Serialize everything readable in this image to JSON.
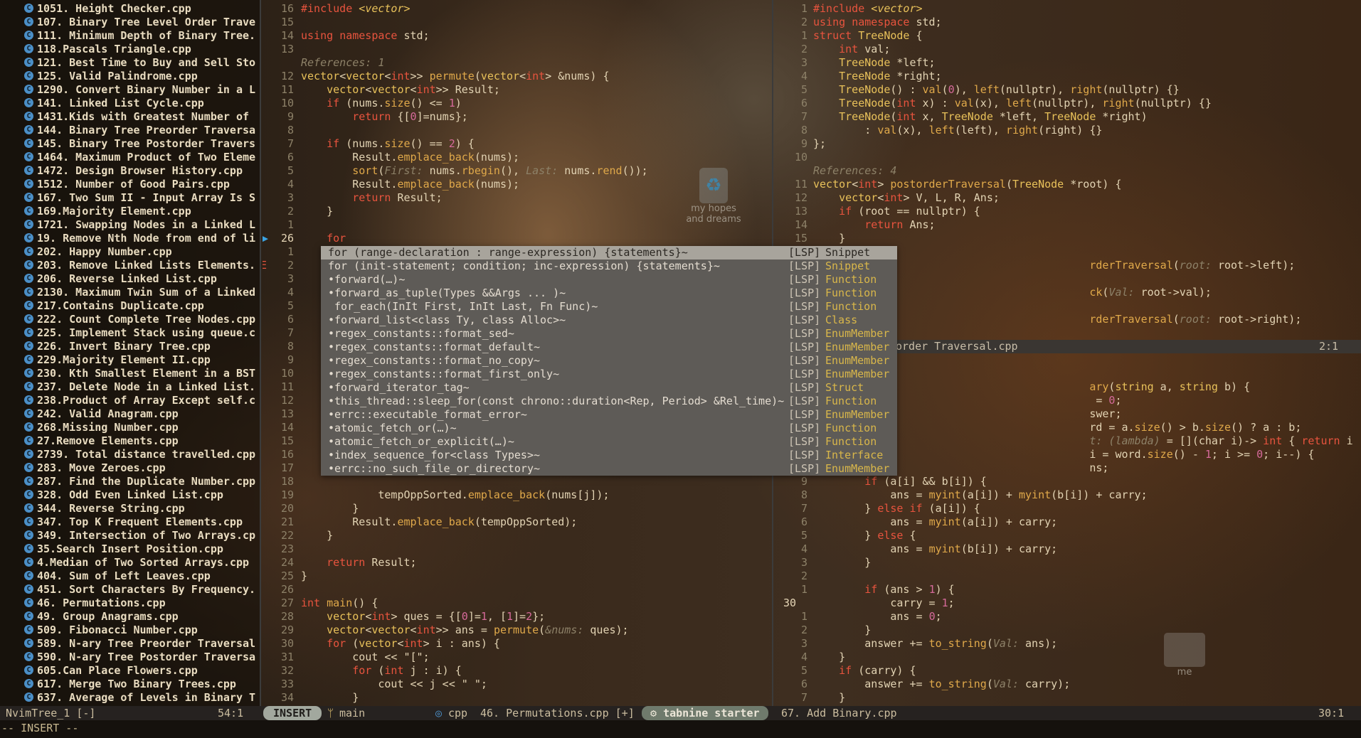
{
  "tree": {
    "items": [
      "1051. Height Checker.cpp",
      "107. Binary Tree Level Order Trave",
      "111. Minimum Depth of Binary Tree.",
      "118.Pascals Triangle.cpp",
      "121. Best Time to Buy and Sell Sto",
      "125. Valid Palindrome.cpp",
      "1290. Convert Binary Number in a L",
      "141. Linked List Cycle.cpp",
      "1431.Kids with Greatest Number of ",
      "144. Binary Tree Preorder Traversa",
      "145. Binary Tree Postorder Travers",
      "1464. Maximum Product of Two Eleme",
      "1472. Design Browser History.cpp",
      "1512. Number of Good Pairs.cpp",
      "167. Two Sum II - Input Array Is S",
      "169.Majority Element.cpp",
      "1721. Swapping Nodes in a Linked L",
      "19. Remove Nth Node from end of li",
      "202. Happy Number.cpp",
      "203. Remove Linked Lists Elements.",
      "206. Reverse Linked List.cpp",
      "2130. Maximum Twin Sum of a Linked",
      "217.Contains Duplicate.cpp",
      "222. Count Complete Tree Nodes.cpp",
      "225. Implement Stack using queue.c",
      "226. Invert Binary Tree.cpp",
      "229.Majority Element II.cpp",
      "230. Kth Smallest Element in a BST",
      "237. Delete Node in a Linked List.",
      "238.Product of Array Except self.c",
      "242. Valid Anagram.cpp",
      "268.Missing Number.cpp",
      "27.Remove Elements.cpp",
      "2739. Total distance travelled.cpp",
      "283. Move Zeroes.cpp",
      "287. Find the Duplicate Number.cpp",
      "328. Odd Even Linked List.cpp",
      "344. Reverse String.cpp",
      "347. Top K Frequent Elements.cpp",
      "349. Intersection of Two Arrays.cp",
      "35.Search Insert Position.cpp",
      "4.Median of Two Sorted Arrays.cpp",
      "404. Sum of Left Leaves.cpp",
      "451. Sort Characters By Frequency.",
      "46. Permutations.cpp",
      "49. Group Anagrams.cpp",
      "509. Fibonacci Number.cpp",
      "589. N-ary Tree Preorder Traversal",
      "590. N-ary Tree Postorder Traversa",
      "605.Can Place Flowers.cpp",
      "617. Merge Two Binary Trees.cpp",
      "637. Average of Levels in Binary T"
    ],
    "icon": "cpp-file-icon"
  },
  "gutter": {
    "error_mark": "E"
  },
  "mid": {
    "nums": [
      "16",
      "15",
      "14",
      "13",
      "",
      "12",
      "11",
      "10",
      "9",
      "8",
      "7",
      "6",
      "5",
      "4",
      "3",
      "2",
      "1",
      "26",
      "1",
      "2",
      "3",
      "4",
      "5",
      "6",
      "7",
      "8",
      "9",
      "10",
      "11",
      "12",
      "13",
      "14",
      "15",
      "16",
      "17",
      "18",
      "19",
      "20",
      "21",
      "22",
      "23",
      "24",
      "25",
      "26",
      "27",
      "28",
      "29",
      "30",
      "31",
      "32",
      "33",
      "34"
    ],
    "references": "References: 1"
  },
  "popup": {
    "items": [
      {
        "label": "for (range-declaration : range-expression) {statements}~",
        "src": "[LSP]",
        "kind": "Snippet"
      },
      {
        "label": "for (init-statement; condition; inc-expression) {statements}~",
        "src": "[LSP]",
        "kind": "Snippet"
      },
      {
        "label": "•forward(…)~",
        "src": "[LSP]",
        "kind": "Function"
      },
      {
        "label": "•forward_as_tuple(Types &&Args ... )~",
        "src": "[LSP]",
        "kind": "Function"
      },
      {
        "label": " for_each(InIt First, InIt Last, Fn Func)~",
        "src": "[LSP]",
        "kind": "Function"
      },
      {
        "label": "•forward_list<class Ty, class Alloc>~",
        "src": "[LSP]",
        "kind": "Class"
      },
      {
        "label": "•regex_constants::format_sed~",
        "src": "[LSP]",
        "kind": "EnumMember"
      },
      {
        "label": "•regex_constants::format_default~",
        "src": "[LSP]",
        "kind": "EnumMember"
      },
      {
        "label": "•regex_constants::format_no_copy~",
        "src": "[LSP]",
        "kind": "EnumMember"
      },
      {
        "label": "•regex_constants::format_first_only~",
        "src": "[LSP]",
        "kind": "EnumMember"
      },
      {
        "label": "•forward_iterator_tag~",
        "src": "[LSP]",
        "kind": "Struct"
      },
      {
        "label": "•this_thread::sleep_for(const chrono::duration<Rep, Period> &Rel_time)~",
        "src": "[LSP]",
        "kind": "Function"
      },
      {
        "label": "•errc::executable_format_error~",
        "src": "[LSP]",
        "kind": "EnumMember"
      },
      {
        "label": "•atomic_fetch_or(…)~",
        "src": "[LSP]",
        "kind": "Function"
      },
      {
        "label": "•atomic_fetch_or_explicit(…)~",
        "src": "[LSP]",
        "kind": "Function"
      },
      {
        "label": "•index_sequence_for<class Types>~",
        "src": "[LSP]",
        "kind": "Interface"
      },
      {
        "label": "•errc::no_such_file_or_directory~",
        "src": "[LSP]",
        "kind": "EnumMember"
      }
    ]
  },
  "right": {
    "nums": [
      "1",
      "2",
      "1",
      "2",
      "3",
      "4",
      "5",
      "6",
      "7",
      "8",
      "9",
      "10",
      "",
      "11",
      "12",
      "13",
      "14",
      "15",
      "",
      "",
      "",
      "",
      "",
      "",
      "",
      "",
      "",
      "",
      "",
      "",
      "",
      "",
      "",
      "",
      "",
      "9",
      "8",
      "7",
      "6",
      "5",
      "4",
      "3",
      "2",
      "1",
      "30",
      "1",
      "2",
      "3",
      "4",
      "5",
      "6",
      "7"
    ],
    "references": "References: 4",
    "inner_status": {
      "file": "order Traversal.cpp",
      "pos": "2:1"
    }
  },
  "status": {
    "tree_name": "NvimTree_1 [-]",
    "tree_pos": "54:1",
    "mode": "INSERT",
    "branch_icon": "ᛘ",
    "branch": "main",
    "lang_icon": "◎",
    "lang": "cpp",
    "file": "46. Permutations.cpp [+]",
    "plugin_icon": "⚙",
    "plugin": "tabnine starter",
    "right_file": "67. Add Binary.cpp",
    "right_pos": "30:1"
  },
  "cmdline": "-- INSERT --",
  "desktop": {
    "recycle_label1": "my hopes",
    "recycle_label2": "and dreams",
    "folder_label": "me"
  },
  "colors": {
    "accent": "#e8543e",
    "type": "#e8c15a",
    "func": "#e0a94a",
    "number": "#d66a9a"
  }
}
